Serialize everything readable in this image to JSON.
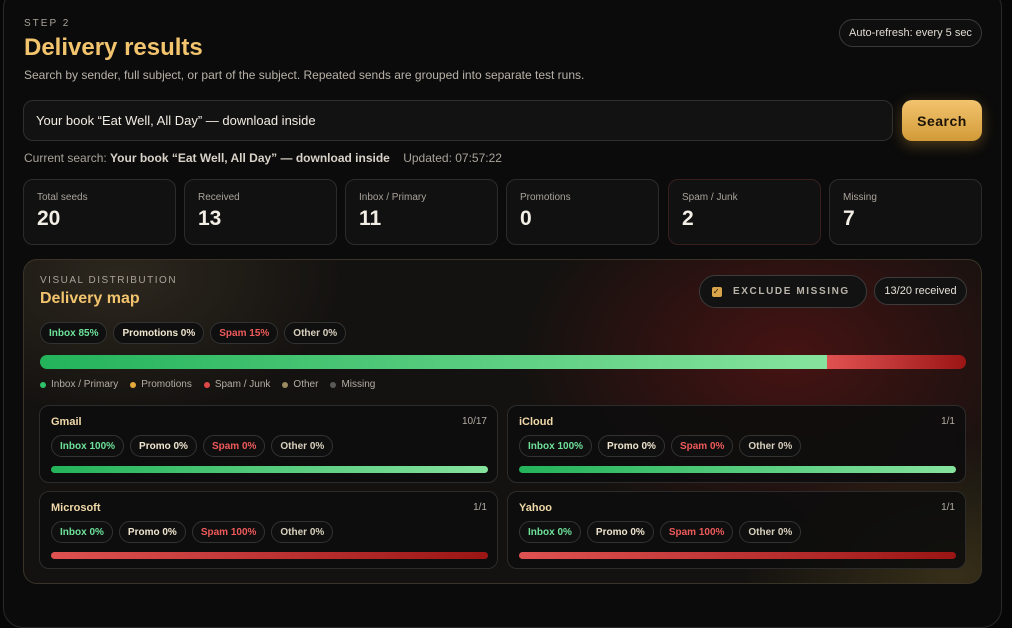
{
  "header": {
    "step": "STEP 2",
    "title": "Delivery results",
    "subtitle": "Search by sender, full subject, or part of the subject. Repeated sends are grouped into separate test runs.",
    "autorefresh": "Auto-refresh: every 5 sec"
  },
  "search": {
    "value": "Your book “Eat Well, All Day” — download inside",
    "button_label": "Search"
  },
  "current": {
    "prefix": "Current search:",
    "query": "Your book “Eat Well, All Day” — download inside",
    "updated": "Updated: 07:57:22"
  },
  "stats": [
    {
      "label": "Total seeds",
      "value": "20"
    },
    {
      "label": "Received",
      "value": "13"
    },
    {
      "label": "Inbox / Primary",
      "value": "11"
    },
    {
      "label": "Promotions",
      "value": "0"
    },
    {
      "label": "Spam / Junk",
      "value": "2"
    },
    {
      "label": "Missing",
      "value": "7"
    }
  ],
  "distribution": {
    "kicker": "VISUAL DISTRIBUTION",
    "title": "Delivery map",
    "exclude_label": "EXCLUDE MISSING",
    "exclude_checked": true,
    "received_label": "13/20 received",
    "chips": {
      "inbox": "Inbox 85%",
      "promo": "Promotions 0%",
      "spam": "Spam 15%",
      "other": "Other 0%"
    },
    "share": {
      "inbox": 0.85,
      "promo": 0,
      "spam": 0.15,
      "other": 0
    },
    "legend": [
      {
        "label": "Inbox / Primary",
        "color": "#2fc26a"
      },
      {
        "label": "Promotions",
        "color": "#e8a93c"
      },
      {
        "label": "Spam / Junk",
        "color": "#e04848"
      },
      {
        "label": "Other",
        "color": "#9c8a60"
      },
      {
        "label": "Missing",
        "color": "#5a5a5a"
      }
    ]
  },
  "providers": [
    {
      "name": "Gmail",
      "count": "10/17",
      "inbox": "Inbox 100%",
      "promo": "Promo 0%",
      "spam": "Spam 0%",
      "other": "Other 0%",
      "share": {
        "inbox": 1,
        "spam": 0
      }
    },
    {
      "name": "iCloud",
      "count": "1/1",
      "inbox": "Inbox 100%",
      "promo": "Promo 0%",
      "spam": "Spam 0%",
      "other": "Other 0%",
      "share": {
        "inbox": 1,
        "spam": 0
      }
    },
    {
      "name": "Microsoft",
      "count": "1/1",
      "inbox": "Inbox 0%",
      "promo": "Promo 0%",
      "spam": "Spam 100%",
      "other": "Other 0%",
      "share": {
        "inbox": 0,
        "spam": 1
      }
    },
    {
      "name": "Yahoo",
      "count": "1/1",
      "inbox": "Inbox 0%",
      "promo": "Promo 0%",
      "spam": "Spam 100%",
      "other": "Other 0%",
      "share": {
        "inbox": 0,
        "spam": 1
      }
    }
  ],
  "colors": {
    "accent": "#f2c46e",
    "inbox": "#2fc26a",
    "spam": "#e04848"
  }
}
